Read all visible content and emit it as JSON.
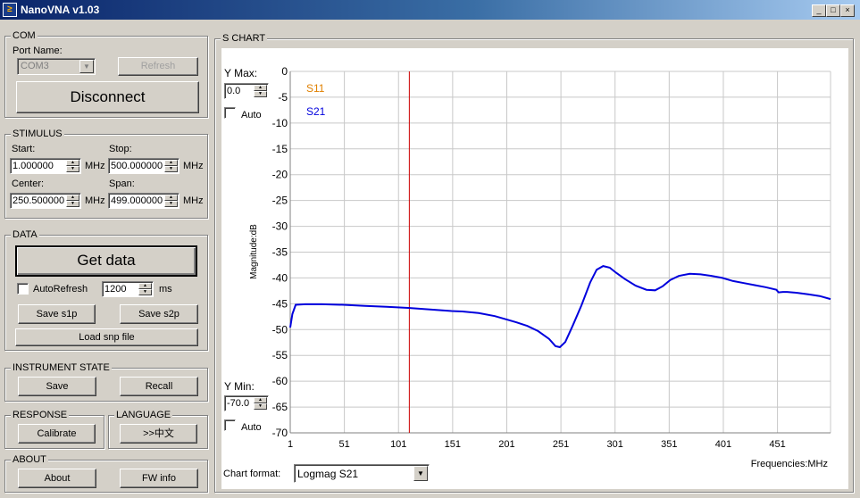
{
  "window": {
    "title": "NanoVNA  v1.03"
  },
  "com": {
    "group_label": "COM",
    "port_name_label": "Port Name:",
    "port_value": "COM3",
    "refresh_label": "Refresh",
    "disconnect_label": "Disconnect"
  },
  "stimulus": {
    "group_label": "STIMULUS",
    "start_label": "Start:",
    "start_value": "1.000000",
    "stop_label": "Stop:",
    "stop_value": "500.000000",
    "center_label": "Center:",
    "center_value": "250.500000",
    "span_label": "Span:",
    "span_value": "499.000000",
    "unit": "MHz"
  },
  "data": {
    "group_label": "DATA",
    "get_data_label": "Get data",
    "autorefresh_label": "AutoRefresh",
    "autorefresh_value": "1200",
    "ms_label": "ms",
    "save_s1p_label": "Save s1p",
    "save_s2p_label": "Save s2p",
    "load_snp_label": "Load snp file"
  },
  "instrument": {
    "group_label": "INSTRUMENT STATE",
    "save_label": "Save",
    "recall_label": "Recall"
  },
  "response": {
    "group_label": "RESPONSE",
    "calibrate_label": "Calibrate"
  },
  "language": {
    "group_label": "LANGUAGE",
    "lang_label": ">>中文"
  },
  "about": {
    "group_label": "ABOUT",
    "about_label": "About",
    "fw_info_label": "FW info"
  },
  "schart": {
    "group_label": "S CHART",
    "ymax_label": "Y Max:",
    "ymax_value": "0.0",
    "ymin_label": "Y Min:",
    "ymin_value": "-70.0",
    "auto_label": "Auto",
    "chart_format_label": "Chart format:",
    "chart_format_value": "Logmag S21"
  },
  "colors": {
    "s11": "#e08000",
    "s21": "#0000dd",
    "marker": "#cc0000",
    "grid": "#c8c8c8"
  },
  "chart_data": {
    "type": "line",
    "xlabel": "Frequencies:MHz",
    "ylabel": "Magnitude:dB",
    "xlim": [
      1,
      500
    ],
    "ylim": [
      -70,
      0
    ],
    "x_ticks": [
      1,
      51,
      101,
      151,
      201,
      251,
      301,
      351,
      401,
      451
    ],
    "y_ticks": [
      0,
      -5,
      -10,
      -15,
      -20,
      -25,
      -30,
      -35,
      -40,
      -45,
      -50,
      -55,
      -60,
      -65,
      -70
    ],
    "grid": true,
    "legend": [
      "S11",
      "S21"
    ],
    "marker_x": 111,
    "series": [
      {
        "name": "S11",
        "x": [],
        "y": []
      },
      {
        "name": "S21",
        "x": [
          1,
          3,
          6,
          15,
          30,
          50,
          70,
          90,
          110,
          130,
          150,
          160,
          175,
          190,
          200,
          210,
          220,
          230,
          240,
          246,
          250,
          255,
          262,
          270,
          278,
          284,
          290,
          296,
          302,
          310,
          320,
          330,
          338,
          345,
          352,
          360,
          370,
          380,
          390,
          400,
          410,
          420,
          430,
          440,
          450,
          452,
          456,
          460,
          470,
          480,
          490,
          500
        ],
        "y": [
          -49.6,
          -47.0,
          -45.2,
          -45.1,
          -45.1,
          -45.2,
          -45.4,
          -45.6,
          -45.8,
          -46.1,
          -46.4,
          -46.5,
          -46.8,
          -47.4,
          -48.0,
          -48.6,
          -49.3,
          -50.3,
          -51.8,
          -53.2,
          -53.4,
          -52.4,
          -49.2,
          -45.3,
          -40.9,
          -38.4,
          -37.7,
          -38.0,
          -39.0,
          -40.2,
          -41.5,
          -42.3,
          -42.4,
          -41.6,
          -40.4,
          -39.6,
          -39.2,
          -39.3,
          -39.6,
          -40.0,
          -40.6,
          -41.0,
          -41.4,
          -41.8,
          -42.3,
          -42.8,
          -42.7,
          -42.7,
          -42.9,
          -43.2,
          -43.5,
          -44.1
        ]
      }
    ]
  }
}
